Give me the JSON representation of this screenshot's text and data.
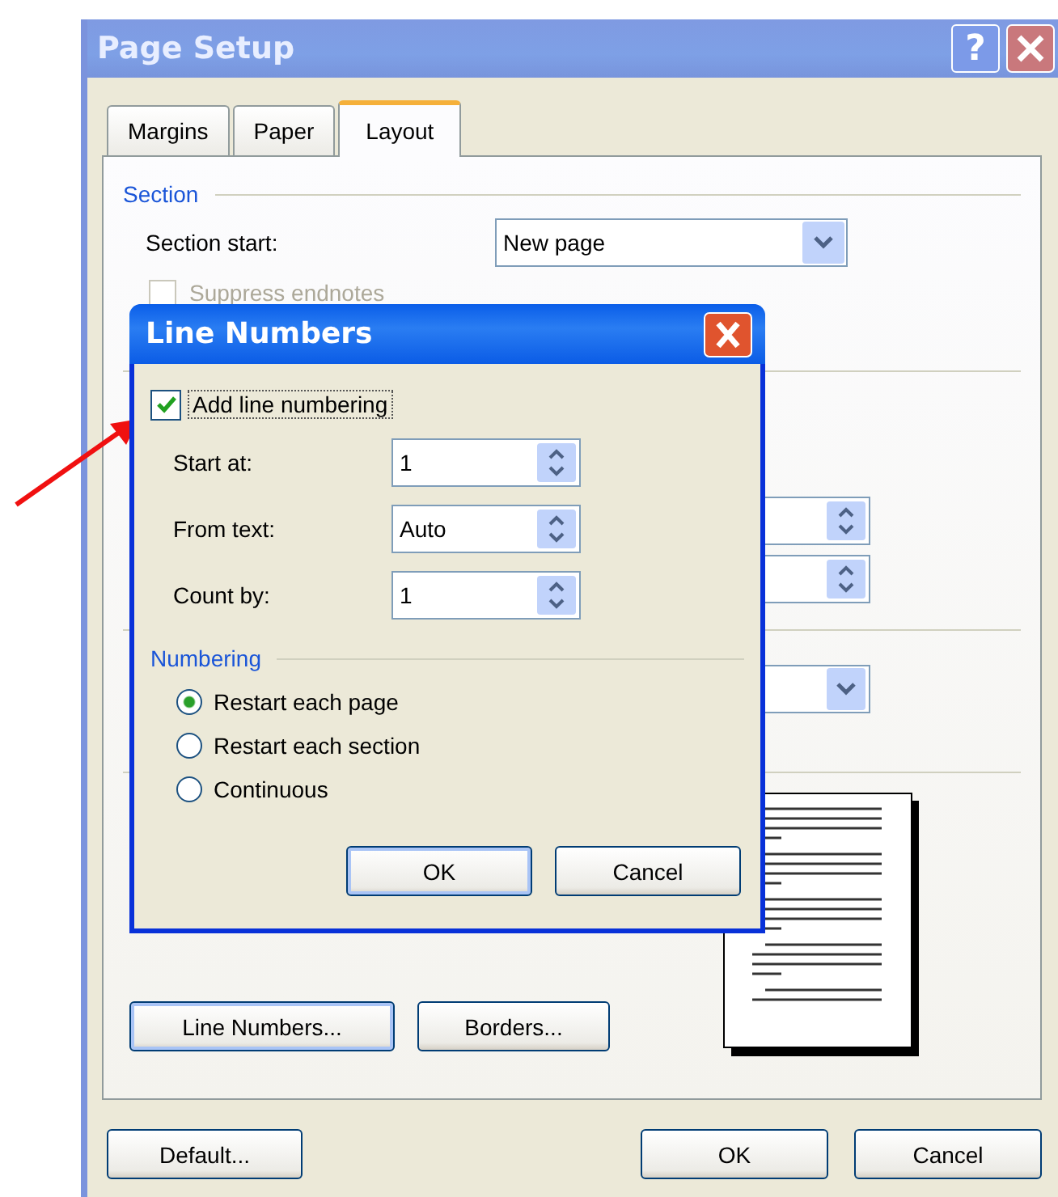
{
  "window": {
    "title": "Page Setup",
    "help_button": "?"
  },
  "tabs": [
    {
      "label": "Margins",
      "selected": false
    },
    {
      "label": "Paper",
      "selected": false
    },
    {
      "label": "Layout",
      "selected": true
    }
  ],
  "section": {
    "heading": "Section",
    "section_start": {
      "label": "Section start:",
      "value": "New page"
    },
    "suppress_endnotes": {
      "label": "Suppress endnotes",
      "checked": false,
      "disabled": true
    }
  },
  "panel_buttons": [
    "Line Numbers...",
    "Borders..."
  ],
  "footer_buttons": [
    "Default...",
    "OK",
    "Cancel"
  ],
  "line_numbers_dialog": {
    "title": "Line Numbers",
    "add_line_numbering": {
      "label": "Add line numbering",
      "checked": true
    },
    "fields": [
      {
        "label": "Start at:",
        "value": "1"
      },
      {
        "label": "From text:",
        "value": "Auto"
      },
      {
        "label": "Count by:",
        "value": "1"
      }
    ],
    "numbering_heading": "Numbering",
    "options": [
      {
        "label": "Restart each page",
        "selected": true
      },
      {
        "label": "Restart each section",
        "selected": false
      },
      {
        "label": "Continuous",
        "selected": false
      }
    ],
    "buttons": [
      "OK",
      "Cancel"
    ]
  }
}
